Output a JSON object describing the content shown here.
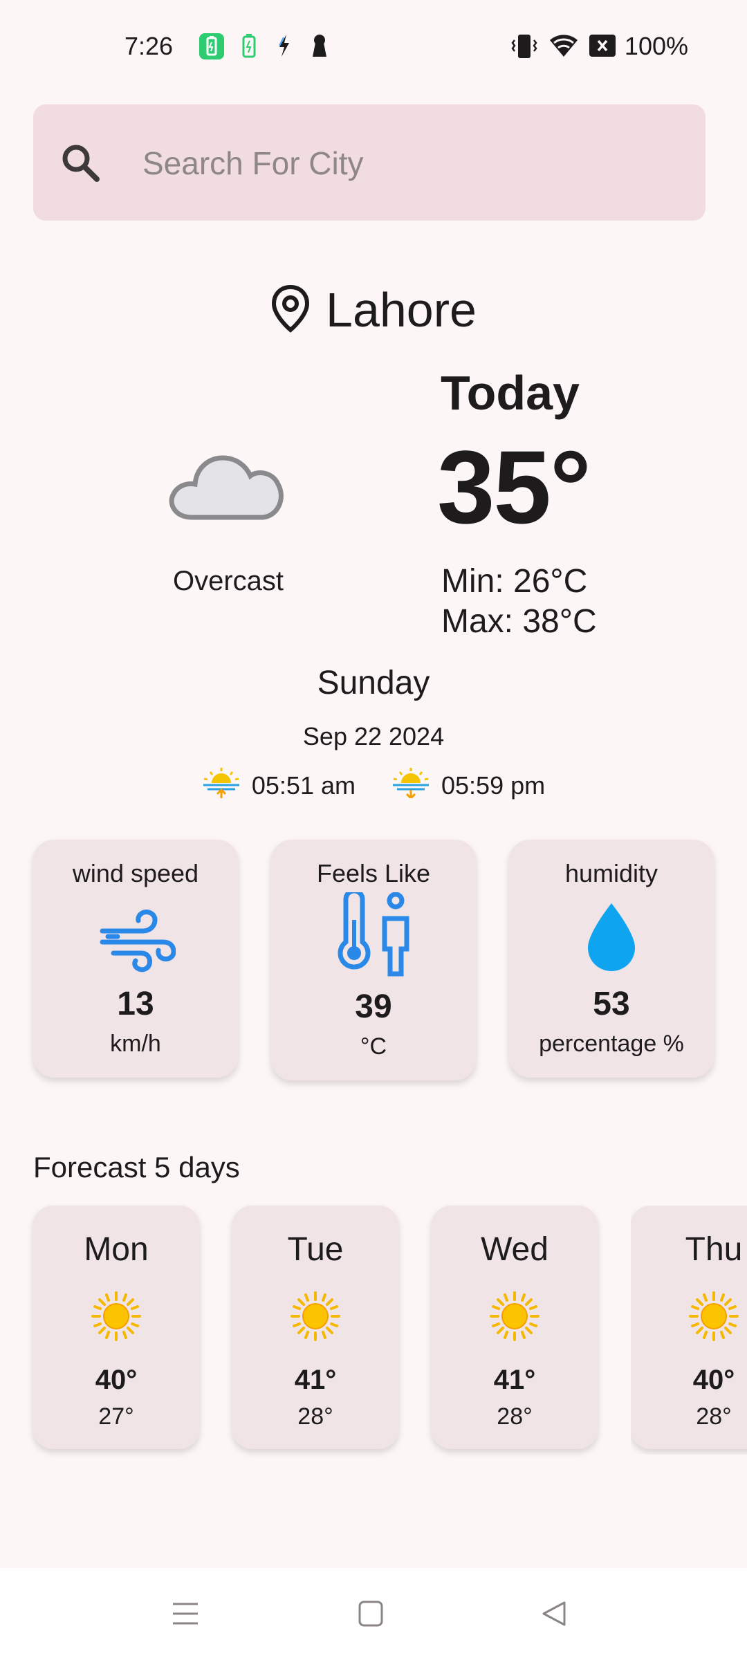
{
  "status_bar": {
    "time": "7:26",
    "battery_text": "100%",
    "icons": [
      "battery-saver-icon",
      "charging-icon",
      "bolt-icon",
      "keyhole-icon",
      "vibrate-icon",
      "wifi-icon",
      "no-sim-icon"
    ]
  },
  "search": {
    "placeholder": "Search For City",
    "value": ""
  },
  "location": {
    "city": "Lahore",
    "icon": "location-pin-icon"
  },
  "current": {
    "condition": "Overcast",
    "condition_icon": "cloud-icon",
    "today_label": "Today",
    "temperature": "35°",
    "min": "Min: 26°C",
    "max": "Max: 38°C",
    "day": "Sunday",
    "date": "Sep 22 2024",
    "sunrise": "05:51 am",
    "sunset": "05:59 pm"
  },
  "details": [
    {
      "title": "wind speed",
      "value": "13",
      "unit": "km/h",
      "icon": "wind-icon"
    },
    {
      "title": "Feels Like",
      "value": "39",
      "unit": "°C",
      "icon": "thermometer-person-icon"
    },
    {
      "title": "humidity",
      "value": "53",
      "unit": "percentage %",
      "icon": "water-drop-icon"
    }
  ],
  "forecast": {
    "title": "Forecast 5 days",
    "days": [
      {
        "day": "Mon",
        "high": "40°",
        "low": "27°",
        "icon": "sun-icon"
      },
      {
        "day": "Tue",
        "high": "41°",
        "low": "28°",
        "icon": "sun-icon"
      },
      {
        "day": "Wed",
        "high": "41°",
        "low": "28°",
        "icon": "sun-icon"
      },
      {
        "day": "Thu",
        "high": "40°",
        "low": "28°",
        "icon": "sun-icon"
      }
    ]
  },
  "colors": {
    "background": "#fdf6f6",
    "search_bg": "#f1dde0",
    "card_bg": "#f1e4e6",
    "accent_blue": "#2a88e8",
    "sun_yellow": "#f5b800"
  }
}
